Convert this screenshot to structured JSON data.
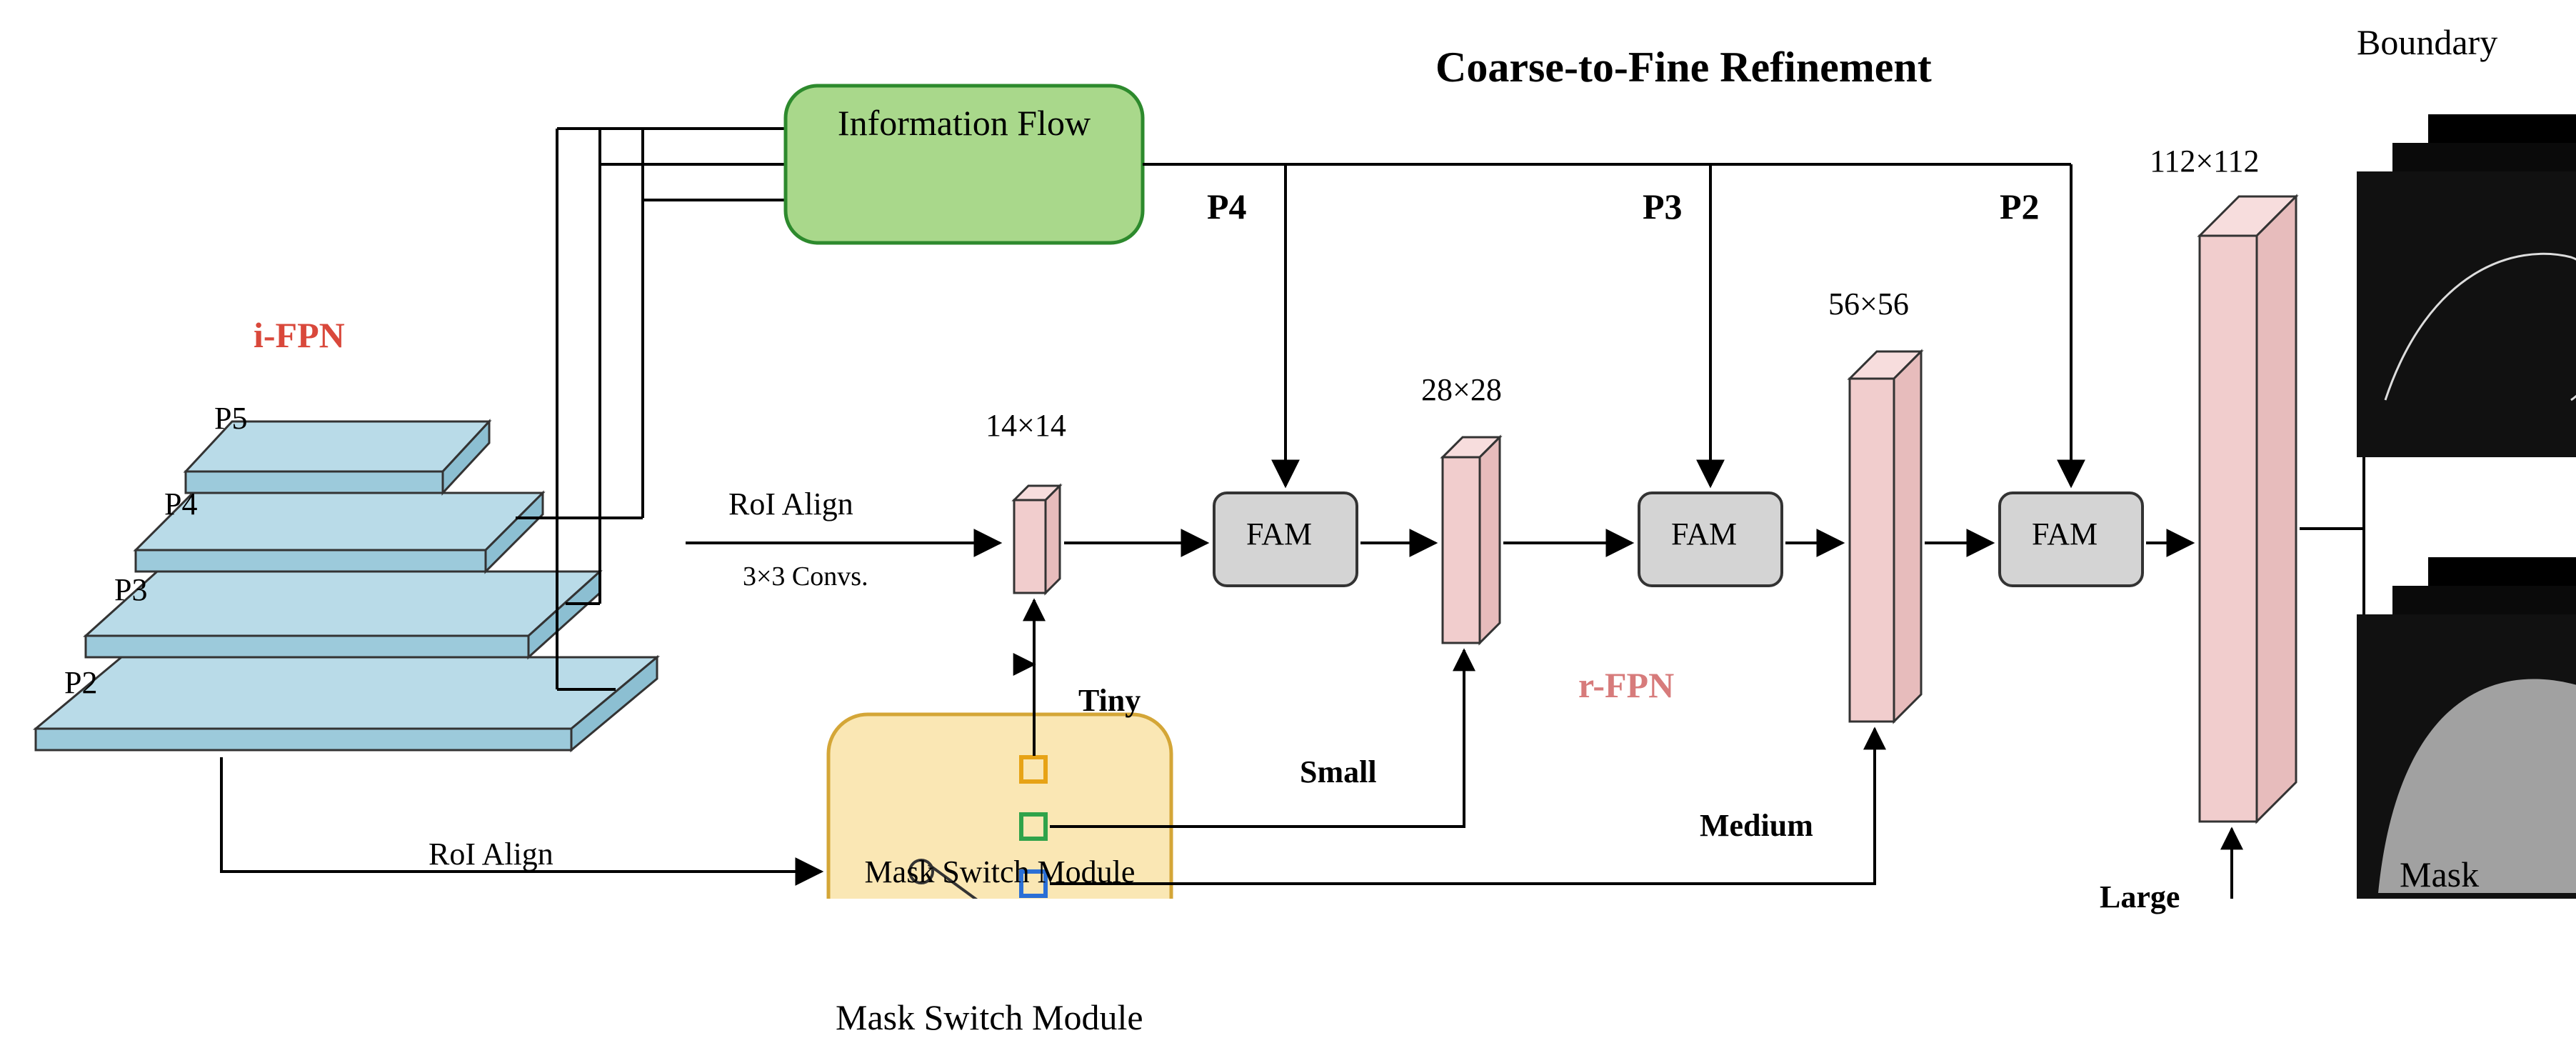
{
  "header": {
    "title": "Coarse-to-Fine Refinement"
  },
  "ifpn": {
    "label": "i-FPN",
    "levels": [
      "P5",
      "P4",
      "P3",
      "P2"
    ]
  },
  "flow": {
    "info_flow": "Information Flow",
    "roi_align": "RoI Align",
    "convs": "3×3 Convs.",
    "roi_align_bottom": "RoI Align"
  },
  "rfpn": {
    "label": "r-FPN",
    "fam": "FAM",
    "sizes": [
      "14×14",
      "28×28",
      "56×56",
      "112×112"
    ],
    "p_labels": [
      "P4",
      "P3",
      "P2"
    ]
  },
  "switch": {
    "label": "Mask Switch Module",
    "tiers": [
      "Tiny",
      "Small",
      "Medium",
      "Large"
    ]
  },
  "outputs": {
    "boundary": "Boundary",
    "mask": "Mask"
  }
}
